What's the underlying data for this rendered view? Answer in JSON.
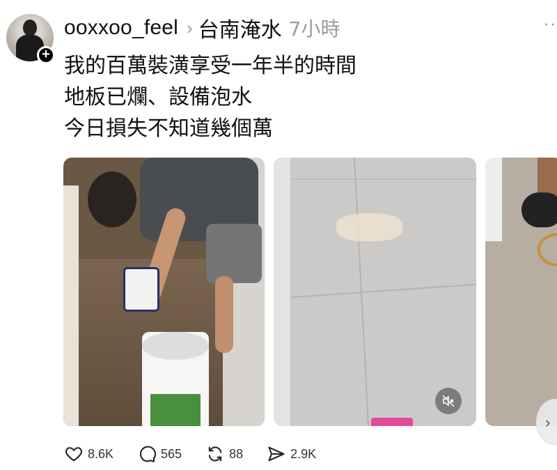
{
  "post": {
    "username": "ooxxoo_feel",
    "topic": "台南淹水",
    "time_ago": "7小時",
    "text_lines": [
      "我的百萬裝潢享受一年半的時間",
      "地板已爛、設備泡水",
      "今日損失不知道幾個萬"
    ]
  },
  "icons": {
    "more": "more-dots-icon",
    "follow": "plus-icon",
    "chevron": "chevron-right-icon",
    "mute": "muted-speaker-icon",
    "like": "heart-icon",
    "reply": "speech-bubble-icon",
    "repost": "repost-arrows-icon",
    "share": "send-paper-plane-icon"
  },
  "actions": {
    "likes": "8.6K",
    "replies": "565",
    "reposts": "88",
    "shares": "2.9K"
  },
  "colors": {
    "muted_text": "#9a9a9a",
    "text": "#101010"
  }
}
